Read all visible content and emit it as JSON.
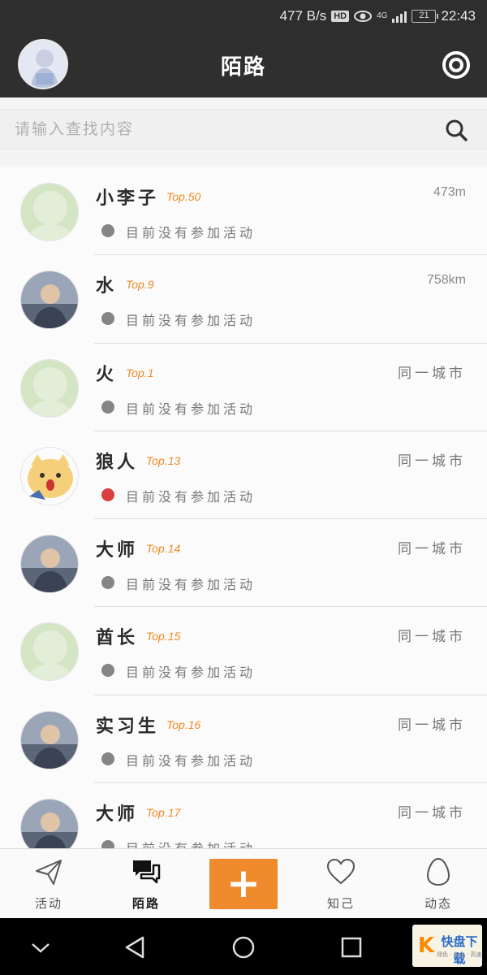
{
  "status_bar": {
    "speed": "477 B/s",
    "hd": "HD",
    "network": "4G",
    "battery": "21",
    "time": "22:43"
  },
  "header": {
    "title": "陌路"
  },
  "search": {
    "placeholder": "请输入查找内容"
  },
  "users": [
    {
      "name": "小李子",
      "rank": "Top.50",
      "distance": "473m",
      "is_city": false,
      "status": "目前没有参加活动",
      "status_color": "#858585",
      "avatar": "default-avatar"
    },
    {
      "name": "水",
      "rank": "Top.9",
      "distance": "758km",
      "is_city": false,
      "status": "目前没有参加活动",
      "status_color": "#858585",
      "avatar": "photo-avatar"
    },
    {
      "name": "火",
      "rank": "Top.1",
      "distance": "同一城市",
      "is_city": true,
      "status": "目前没有参加活动",
      "status_color": "#858585",
      "avatar": "default-avatar"
    },
    {
      "name": "狼人",
      "rank": "Top.13",
      "distance": "同一城市",
      "is_city": true,
      "status": "目前没有参加活动",
      "status_color": "#d9403e",
      "avatar": "cartoon-dog-avatar"
    },
    {
      "name": "大师",
      "rank": "Top.14",
      "distance": "同一城市",
      "is_city": true,
      "status": "目前没有参加活动",
      "status_color": "#858585",
      "avatar": "photo-avatar"
    },
    {
      "name": "酋长",
      "rank": "Top.15",
      "distance": "同一城市",
      "is_city": true,
      "status": "目前没有参加活动",
      "status_color": "#858585",
      "avatar": "default-avatar"
    },
    {
      "name": "实习生",
      "rank": "Top.16",
      "distance": "同一城市",
      "is_city": true,
      "status": "目前没有参加活动",
      "status_color": "#858585",
      "avatar": "photo-avatar"
    },
    {
      "name": "大师",
      "rank": "Top.17",
      "distance": "同一城市",
      "is_city": true,
      "status": "目前没有参加活动",
      "status_color": "#858585",
      "avatar": "photo-avatar"
    }
  ],
  "bottom_nav": {
    "activity": "活动",
    "strangers": "陌路",
    "add": "+",
    "friends": "知己",
    "moments": "动态"
  },
  "watermark": {
    "brand": "快盘下载",
    "sub": "绿色 · 安全 · 高速"
  },
  "colors": {
    "accent": "#ef8a2d",
    "rank": "#ee8a23",
    "header_bg": "#2f2f2f",
    "status_red": "#d9403e"
  }
}
